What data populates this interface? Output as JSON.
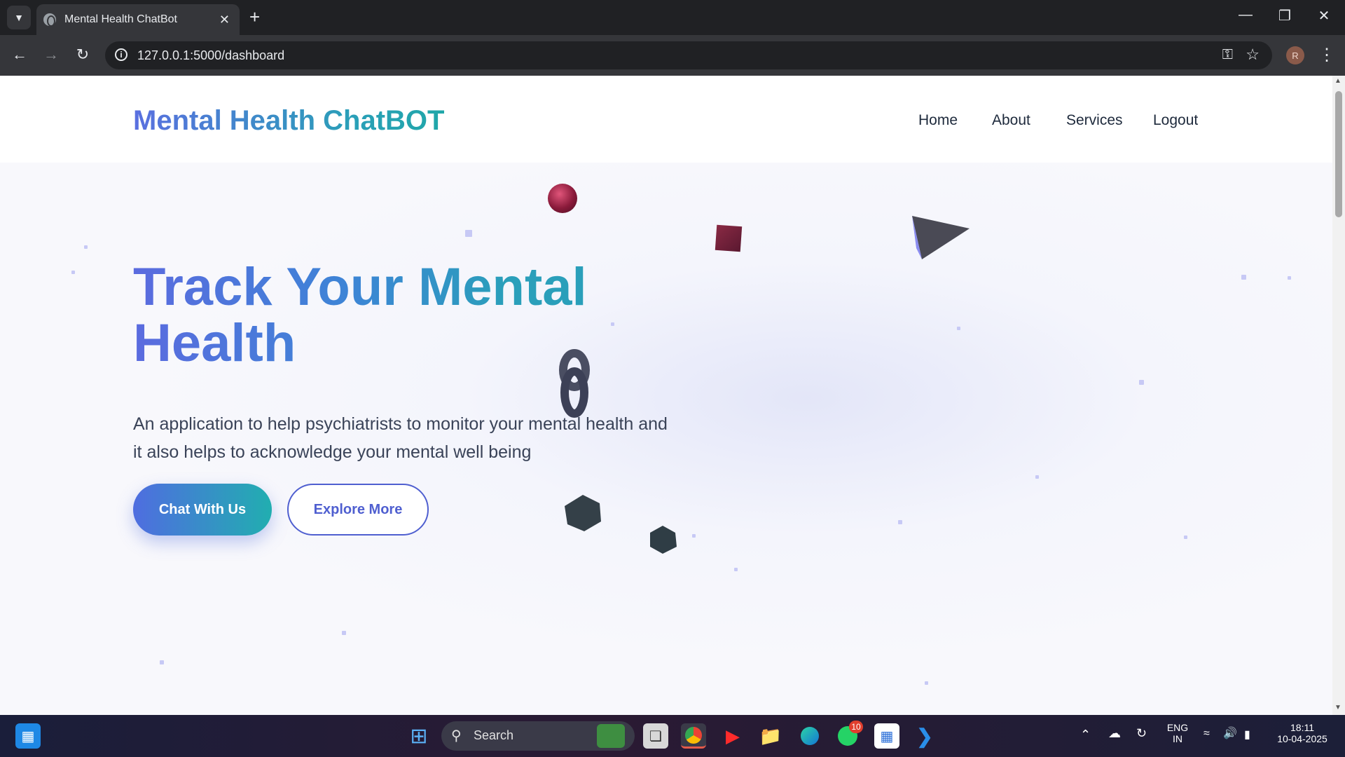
{
  "browser": {
    "tab_title": "Mental Health ChatBot",
    "url": "127.0.0.1:5000/dashboard",
    "profile_initial": "R"
  },
  "site": {
    "logo": "Mental Health ChatBOT",
    "nav": [
      "Home",
      "About",
      "Services",
      "Logout"
    ]
  },
  "hero": {
    "title": "Track Your Mental Health",
    "subtitle": "An application to help psychiatrists to monitor your mental health and it also helps to acknowledge your mental well being",
    "primary_button": "Chat With Us",
    "secondary_button": "Explore More"
  },
  "taskbar": {
    "search_placeholder": "Search",
    "whatsapp_badge": "10",
    "language": "ENG",
    "region": "IN",
    "time": "18:11",
    "date": "10-04-2025"
  },
  "colors": {
    "brand_gradient_start": "#5b6bdf",
    "brand_gradient_end": "#21aeb0",
    "nav_text": "#1e2a3c"
  }
}
